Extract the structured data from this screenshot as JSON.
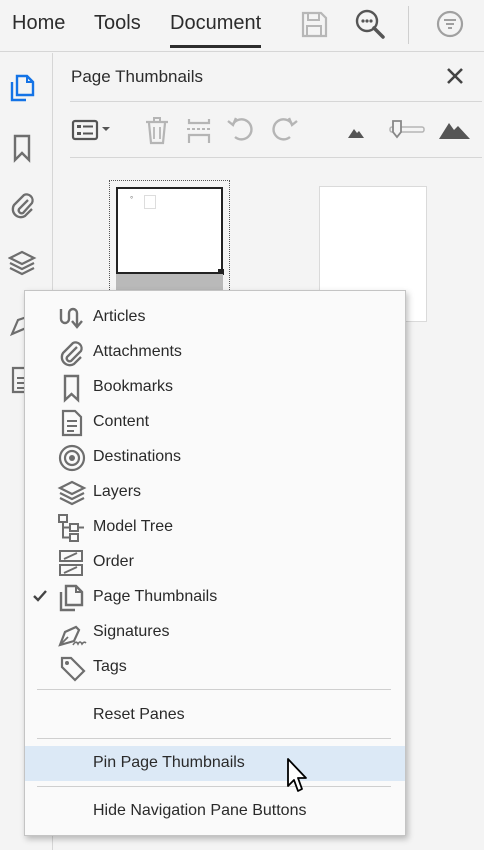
{
  "topbar": {
    "tabs": [
      {
        "label": "Home"
      },
      {
        "label": "Tools"
      },
      {
        "label": "Document",
        "active": true
      }
    ],
    "icons": [
      "save-icon",
      "search-zoom-icon",
      "collapse-circle-icon"
    ]
  },
  "rail": {
    "icons": [
      "page-thumbnails-icon",
      "bookmark-icon",
      "attachment-icon",
      "layers-icon",
      "signature-pen-icon",
      "content-icon"
    ]
  },
  "panel": {
    "title": "Page Thumbnails",
    "toolbar_icons": [
      "options-menu-icon",
      "delete-icon",
      "split-page-icon",
      "rotate-left-icon",
      "rotate-right-icon",
      "zoom-out-mountain-icon",
      "zoom-slider-icon",
      "zoom-in-mountain-icon"
    ],
    "selected_page_marker": "°"
  },
  "menu": {
    "items": [
      {
        "label": "Articles",
        "icon": "articles-icon"
      },
      {
        "label": "Attachments",
        "icon": "paperclip-icon"
      },
      {
        "label": "Bookmarks",
        "icon": "bookmark-icon"
      },
      {
        "label": "Content",
        "icon": "content-icon"
      },
      {
        "label": "Destinations",
        "icon": "target-icon"
      },
      {
        "label": "Layers",
        "icon": "layers-icon"
      },
      {
        "label": "Model Tree",
        "icon": "model-tree-icon"
      },
      {
        "label": "Order",
        "icon": "order-icon"
      },
      {
        "label": "Page Thumbnails",
        "icon": "pages-icon",
        "checked": true
      },
      {
        "label": "Signatures",
        "icon": "signature-icon"
      },
      {
        "label": "Tags",
        "icon": "tag-icon"
      }
    ],
    "reset": "Reset Panes",
    "pin": "Pin Page Thumbnails",
    "hide": "Hide Navigation Pane Buttons"
  },
  "colors": {
    "background": "#f4f4f4",
    "menu_background": "#fafafa",
    "highlight": "#dce9f6",
    "icon_gray": "#6e6e6e",
    "active_blue": "#1473e6"
  }
}
